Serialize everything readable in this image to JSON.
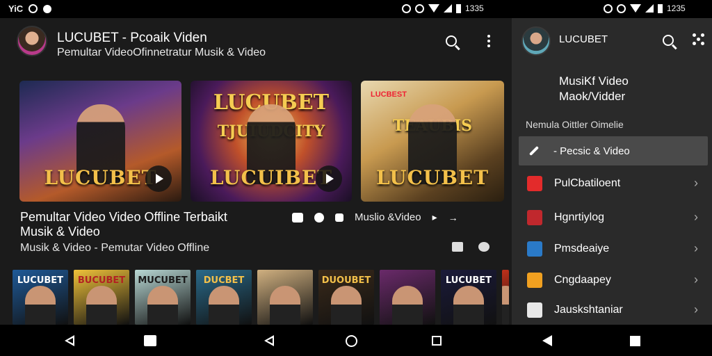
{
  "status_bar": {
    "left_text": "YiC",
    "time_left": "1335",
    "time_right": "1235"
  },
  "main": {
    "app_title": "LUCUBET - Pcoaik Viden",
    "app_subtitle": "Pemultar VideoOfinnetratur Musik & Video",
    "featured": [
      {
        "overlay": "LUCUBET",
        "top": "",
        "mid": "",
        "tag": ""
      },
      {
        "overlay": "LUCUIBET",
        "top": "LUCUBET",
        "mid": "TJUIUDCITY",
        "tag": ""
      },
      {
        "overlay": "LUCUBET",
        "top": "",
        "mid": "TEAUBIS",
        "tag": "LUCBEST"
      }
    ],
    "video_title": "Pemultar Video Video Offline Terbaikt Musik & Video",
    "video_meta": "Musik & Video - Pemutar Video Offline",
    "action_label": "Muslio &Video",
    "thumbnails": [
      {
        "label": "LUCUBET",
        "bg": "#1f5a98",
        "fg": "#ffffff"
      },
      {
        "label": "BUCUBET",
        "bg": "#f0c23a",
        "fg": "#b22222"
      },
      {
        "label": "MUCUBET",
        "bg": "#b8d8d4",
        "fg": "#1a1a1a"
      },
      {
        "label": "DUCBET",
        "bg": "#2a6a8a",
        "fg": "#f3c04a"
      },
      {
        "label": "",
        "bg": "#d0b080",
        "fg": "#ffffff"
      },
      {
        "label": "DUOUBET",
        "bg": "#3a2a1a",
        "fg": "#f3c04a"
      },
      {
        "label": "",
        "bg": "#6a2a6a",
        "fg": "#ffffff"
      },
      {
        "label": "LUCUBET",
        "bg": "#1a1a3a",
        "fg": "#ffffff"
      },
      {
        "label": "",
        "bg": "#c0301a",
        "fg": "#ffffff"
      }
    ]
  },
  "side": {
    "title": "LUCUBET",
    "heading_line1": "MusiKf Video",
    "heading_line2": "Maok/Vidder",
    "section": "Nemula Oittler Oimelie",
    "active_item": "- Pecsic & Video",
    "items": [
      {
        "label": "PulCbatiloent",
        "icon_color": "#e32b2b"
      },
      {
        "label": "Hgnrtiylog",
        "icon_color": "#c0282d"
      },
      {
        "label": "Pmsdeaiye",
        "icon_color": "#2a7ac8"
      },
      {
        "label": "Cngdaapey",
        "icon_color": "#f0a020"
      },
      {
        "label": "Jauskshtaniar",
        "icon_color": "#e8e8e8"
      }
    ]
  }
}
